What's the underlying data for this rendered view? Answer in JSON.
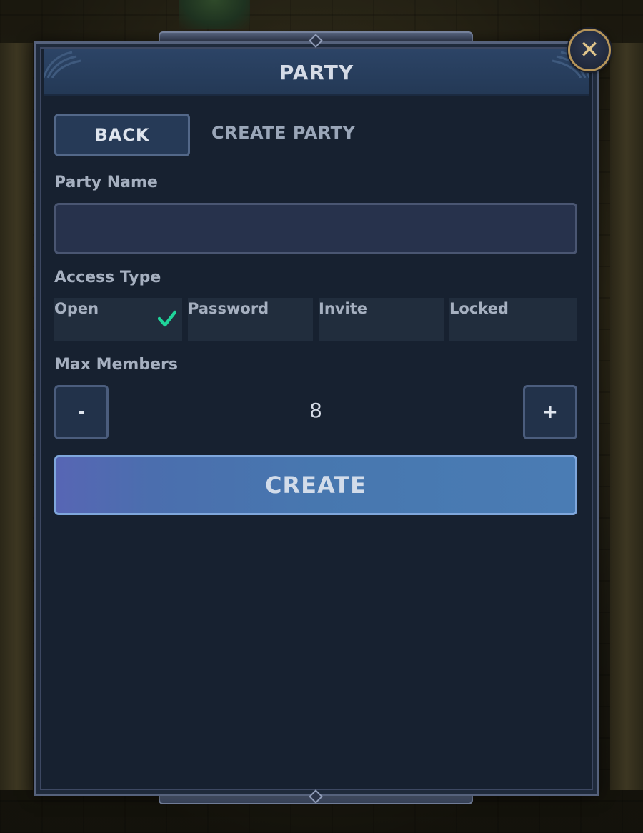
{
  "window": {
    "title": "PARTY",
    "close_glyph": "✕"
  },
  "nav": {
    "back_label": "BACK",
    "subtitle": "CREATE PARTY"
  },
  "form": {
    "party_name": {
      "label": "Party Name",
      "value": ""
    },
    "access_type": {
      "label": "Access Type",
      "options": [
        {
          "label": "Open",
          "selected": true
        },
        {
          "label": "Password",
          "selected": false
        },
        {
          "label": "Invite",
          "selected": false
        },
        {
          "label": "Locked",
          "selected": false
        }
      ]
    },
    "max_members": {
      "label": "Max Members",
      "decrement_label": "-",
      "increment_label": "+",
      "value": "8"
    },
    "submit_label": "CREATE"
  },
  "icons": {
    "close": "close-icon",
    "selected_check": "checkmark-icon"
  },
  "colors": {
    "accent_check": "#1fd49a",
    "panel_bg": "#172130",
    "header_bg": "#2c4466",
    "create_button": "#4777af",
    "close_ring": "#b6955a"
  }
}
